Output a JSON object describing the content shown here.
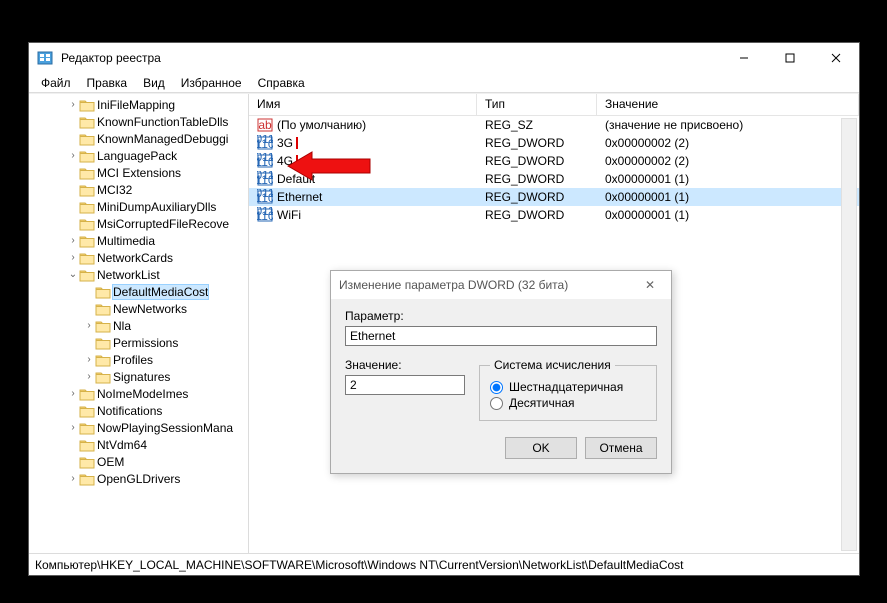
{
  "window": {
    "title": "Редактор реестра"
  },
  "menu": [
    "Файл",
    "Правка",
    "Вид",
    "Избранное",
    "Справка"
  ],
  "tree": [
    {
      "depth": 2,
      "exp": "›",
      "label": "IniFileMapping"
    },
    {
      "depth": 2,
      "exp": "",
      "label": "KnownFunctionTableDlls"
    },
    {
      "depth": 2,
      "exp": "",
      "label": "KnownManagedDebuggi"
    },
    {
      "depth": 2,
      "exp": "›",
      "label": "LanguagePack"
    },
    {
      "depth": 2,
      "exp": "",
      "label": "MCI Extensions"
    },
    {
      "depth": 2,
      "exp": "",
      "label": "MCI32"
    },
    {
      "depth": 2,
      "exp": "",
      "label": "MiniDumpAuxiliaryDlls"
    },
    {
      "depth": 2,
      "exp": "",
      "label": "MsiCorruptedFileRecove"
    },
    {
      "depth": 2,
      "exp": "›",
      "label": "Multimedia"
    },
    {
      "depth": 2,
      "exp": "›",
      "label": "NetworkCards"
    },
    {
      "depth": 2,
      "exp": "⌄",
      "label": "NetworkList"
    },
    {
      "depth": 3,
      "exp": "",
      "label": "DefaultMediaCost",
      "selected": true
    },
    {
      "depth": 3,
      "exp": "",
      "label": "NewNetworks"
    },
    {
      "depth": 3,
      "exp": "›",
      "label": "Nla"
    },
    {
      "depth": 3,
      "exp": "",
      "label": "Permissions"
    },
    {
      "depth": 3,
      "exp": "›",
      "label": "Profiles"
    },
    {
      "depth": 3,
      "exp": "›",
      "label": "Signatures"
    },
    {
      "depth": 2,
      "exp": "›",
      "label": "NoImeModeImes"
    },
    {
      "depth": 2,
      "exp": "",
      "label": "Notifications"
    },
    {
      "depth": 2,
      "exp": "›",
      "label": "NowPlayingSessionMana"
    },
    {
      "depth": 2,
      "exp": "",
      "label": "NtVdm64"
    },
    {
      "depth": 2,
      "exp": "",
      "label": "OEM"
    },
    {
      "depth": 2,
      "exp": "›",
      "label": "OpenGLDrivers"
    }
  ],
  "columns": {
    "name": "Имя",
    "type": "Тип",
    "value": "Значение"
  },
  "values": [
    {
      "icon": "sz",
      "name": "(По умолчанию)",
      "type": "REG_SZ",
      "value": "(значение не присвоено)"
    },
    {
      "icon": "dword",
      "name": "3G",
      "type": "REG_DWORD",
      "value": "0x00000002 (2)",
      "mark": true
    },
    {
      "icon": "dword",
      "name": "4G",
      "type": "REG_DWORD",
      "value": "0x00000002 (2)",
      "mark": true
    },
    {
      "icon": "dword",
      "name": "Default",
      "type": "REG_DWORD",
      "value": "0x00000001 (1)"
    },
    {
      "icon": "dword",
      "name": "Ethernet",
      "type": "REG_DWORD",
      "value": "0x00000001 (1)",
      "selected": true
    },
    {
      "icon": "dword",
      "name": "WiFi",
      "type": "REG_DWORD",
      "value": "0x00000001 (1)"
    }
  ],
  "dialog": {
    "title": "Изменение параметра DWORD (32 бита)",
    "param_label": "Параметр:",
    "param_value": "Ethernet",
    "value_label": "Значение:",
    "value_value": "2",
    "radix_legend": "Система исчисления",
    "radix_hex": "Шестнадцатеричная",
    "radix_dec": "Десятичная",
    "ok": "OK",
    "cancel": "Отмена"
  },
  "statusbar": "Компьютер\\HKEY_LOCAL_MACHINE\\SOFTWARE\\Microsoft\\Windows NT\\CurrentVersion\\NetworkList\\DefaultMediaCost"
}
